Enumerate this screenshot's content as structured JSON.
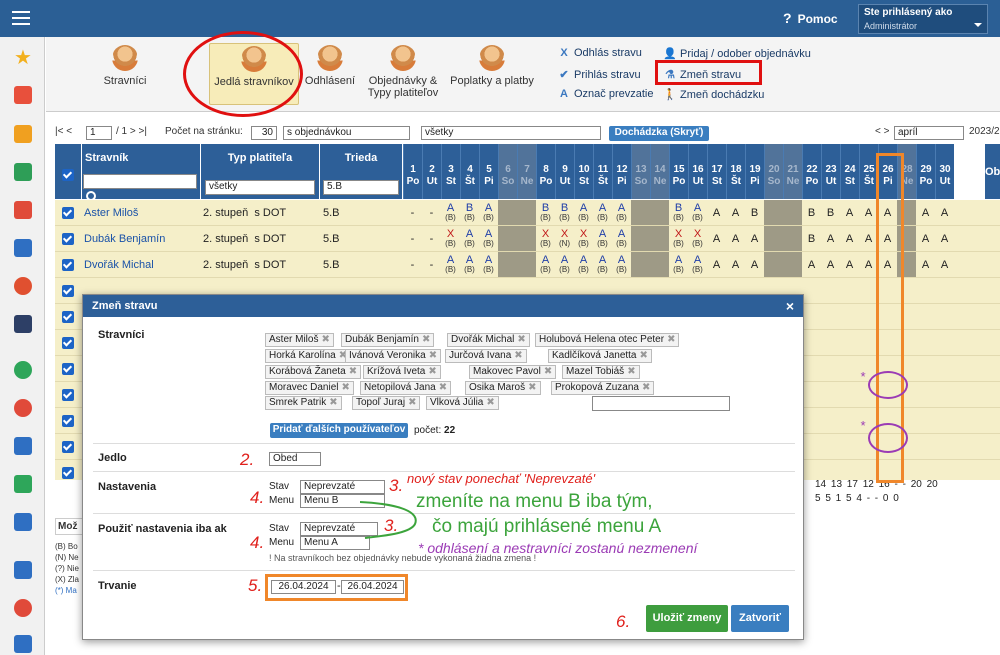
{
  "topbar": {
    "help_label": "Pomoc",
    "help_glyph": "?",
    "user_line1": "Ste prihlásený ako",
    "user_line2": "Administrátor"
  },
  "ribbon": {
    "buttons": [
      {
        "label": "Stravníci"
      },
      {
        "label": "Jedlá stravníkov"
      },
      {
        "label": "Odhlásení"
      },
      {
        "label": "Objednávky &\nTypy platiteľov"
      },
      {
        "label": "Poplatky a platby"
      }
    ],
    "links": [
      {
        "label": "Odhlás stravu",
        "glyph": "X"
      },
      {
        "label": "Prihlás stravu",
        "glyph": "✔"
      },
      {
        "label": "Označ prevzatie",
        "glyph": "A"
      },
      {
        "label": "Pridaj / odober objednávku",
        "glyph": "👤"
      },
      {
        "label": "Zmeň stravu",
        "glyph": "⚗"
      },
      {
        "label": "Zmeň dochádzku",
        "glyph": "🚶"
      }
    ]
  },
  "pager": {
    "nav": "|< <",
    "page": "1",
    "of": "/ 1 > >|",
    "per_page_label": "Počet na stránku:",
    "per_page": "30",
    "filter1": "s objednávkou",
    "filter2": "všetky",
    "attendance_btn": "Dochádzka (Skryť)",
    "month_nav": "< >",
    "month": "apríl",
    "year": "2023/2"
  },
  "grid": {
    "col_headers": {
      "name": "Stravník",
      "type": "Typ platiteľa",
      "class": "Trieda"
    },
    "filters": {
      "type": "všetky",
      "class": "5.B"
    },
    "days": [
      {
        "n": "1",
        "d": "Po",
        "we": false
      },
      {
        "n": "2",
        "d": "Ut",
        "we": false
      },
      {
        "n": "3",
        "d": "St",
        "we": false
      },
      {
        "n": "4",
        "d": "Št",
        "we": false
      },
      {
        "n": "5",
        "d": "Pi",
        "we": false
      },
      {
        "n": "6",
        "d": "So",
        "we": true
      },
      {
        "n": "7",
        "d": "Ne",
        "we": true
      },
      {
        "n": "8",
        "d": "Po",
        "we": false
      },
      {
        "n": "9",
        "d": "Ut",
        "we": false
      },
      {
        "n": "10",
        "d": "St",
        "we": false
      },
      {
        "n": "11",
        "d": "Št",
        "we": false
      },
      {
        "n": "12",
        "d": "Pi",
        "we": false
      },
      {
        "n": "13",
        "d": "So",
        "we": true
      },
      {
        "n": "14",
        "d": "Ne",
        "we": true
      },
      {
        "n": "15",
        "d": "Po",
        "we": false
      },
      {
        "n": "16",
        "d": "Ut",
        "we": false
      },
      {
        "n": "17",
        "d": "St",
        "we": false
      },
      {
        "n": "18",
        "d": "Št",
        "we": false
      },
      {
        "n": "19",
        "d": "Pi",
        "we": false
      },
      {
        "n": "20",
        "d": "So",
        "we": true
      },
      {
        "n": "21",
        "d": "Ne",
        "we": true
      },
      {
        "n": "22",
        "d": "Po",
        "we": false
      },
      {
        "n": "23",
        "d": "Ut",
        "we": false
      },
      {
        "n": "24",
        "d": "St",
        "we": false
      },
      {
        "n": "25",
        "d": "Št",
        "we": false
      },
      {
        "n": "26",
        "d": "Pi",
        "we": false
      },
      {
        "n": "28",
        "d": "Ne",
        "we": true
      },
      {
        "n": "29",
        "d": "Po",
        "we": false
      },
      {
        "n": "30",
        "d": "Ut",
        "we": false
      }
    ],
    "extra_header": "Obj",
    "rows": [
      {
        "name": "Aster Miloš",
        "type": "2. stupeň  s DOT",
        "class": "5.B",
        "cells": [
          "-",
          "-",
          "A|(B)",
          "B|(B)",
          "A|(B)",
          "",
          "",
          "B|(B)",
          "B|(B)",
          "A|(B)",
          "A|(B)",
          "A|(B)",
          "",
          "",
          "B|(B)",
          "A|(B)",
          "A",
          "A",
          "B",
          "",
          "",
          "B",
          "B",
          "A",
          "A",
          "A",
          "",
          "A",
          "A"
        ]
      },
      {
        "name": "Dubák Benjamín",
        "type": "2. stupeň  s DOT",
        "class": "5.B",
        "cells": [
          "-",
          "-",
          "X|(B)",
          "A|(B)",
          "A|(B)",
          "",
          "",
          "X|(B)",
          "X|(N)",
          "X|(B)",
          "A|(B)",
          "A|(B)",
          "",
          "",
          "X|(B)",
          "X|(B)",
          "A",
          "A",
          "A",
          "",
          "",
          "B",
          "A",
          "A",
          "A",
          "A",
          "",
          "A",
          "A"
        ]
      },
      {
        "name": "Dvořák Michal",
        "type": "2. stupeň  s DOT",
        "class": "5.B",
        "cells": [
          "-",
          "-",
          "A|(B)",
          "A|(B)",
          "A|(B)",
          "",
          "",
          "A|(B)",
          "A|(B)",
          "A|(B)",
          "A|(B)",
          "A|(B)",
          "",
          "",
          "A|(B)",
          "A|(B)",
          "A",
          "A",
          "A",
          "",
          "",
          "A",
          "A",
          "A",
          "A",
          "A",
          "",
          "A",
          "A"
        ]
      }
    ]
  },
  "dialog": {
    "title": "Zmeň stravu",
    "close": "×",
    "labels": {
      "stravnici": "Stravníci",
      "jedlo": "Jedlo",
      "nastavenia": "Nastavenia",
      "pouzit": "Použiť nastavenia iba ak",
      "trvanie": "Trvanie"
    },
    "chips": [
      "Aster Miloš",
      "Dubák Benjamín",
      "Dvořák Michal",
      "Holubová Helena otec Peter",
      "Horká Karolína",
      "Ivánová Veronika",
      "Jurčová Ivana",
      "Kadlčíková Janetta",
      "Korábová Žaneta",
      "Krížová Iveta",
      "Makovec Pavol",
      "Mazel Tobiáš",
      "Moravec Daniel",
      "Netopilová Jana",
      "Osika Maroš",
      "Prokopová Zuzana",
      "Smrek Patrik",
      "Topoľ Juraj",
      "Vlková Júlia"
    ],
    "add_users_btn": "Pridať ďalších používateľov",
    "count_label": "počet:",
    "count": "22",
    "jedlo_value": "Obed",
    "set_stav_label": "Stav",
    "set_stav_value": "Neprevzaté",
    "set_menu_label": "Menu",
    "set_menu_value": "Menu B",
    "cond_stav_label": "Stav",
    "cond_stav_value": "Neprevzaté",
    "cond_menu_label": "Menu",
    "cond_menu_value": "Menu A",
    "note": "! Na stravníkoch bez objednávky nebude vykonaná žiadna zmena !",
    "date_from": "26.04.2024",
    "date_dash": "-",
    "date_to": "26.04.2024",
    "save_btn": "Uložiť zmeny",
    "close_btn": "Zatvoriť"
  },
  "annotations": {
    "n2": "2.",
    "n3a": "3.",
    "n3b": "3.",
    "n4a": "4.",
    "n4b": "4.",
    "n5": "5.",
    "n6": "6.",
    "a1": "nový stav ponechať 'Neprevzaté'",
    "a2": "zmeníte na menu B iba tým,",
    "a3": "čo majú prihlásené menu A",
    "a4": "* odhlásení a nestravníci zostanú nezmenení"
  },
  "bottom": {
    "row1": "14  13  17  12  16   -    -   20  20",
    "row2": "5   5   1   5   4    -    -    0   0",
    "left_panel_title": "Mož",
    "legend": [
      "(B) Bo",
      "(N) Ne",
      "(?) Nie",
      "(X) Zla",
      "(*) Ma"
    ]
  },
  "colors": {
    "header_blue": "#2d5f98",
    "accent_red": "#e01010",
    "orange": "#f0872a",
    "purple": "#9b3bb5",
    "green": "#3e9d3e"
  }
}
